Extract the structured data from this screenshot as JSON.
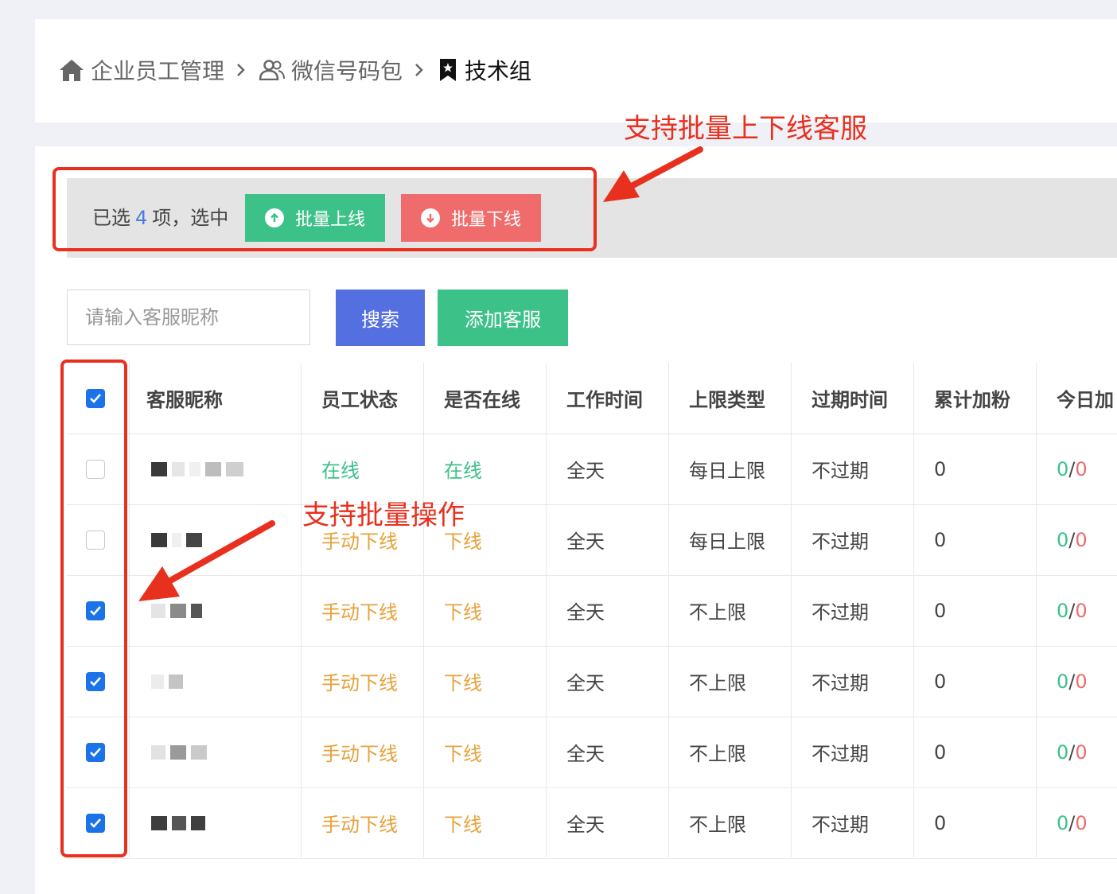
{
  "breadcrumb": {
    "items": [
      {
        "label": "企业员工管理",
        "icon": "home-icon"
      },
      {
        "label": "微信号码包",
        "icon": "users-icon"
      },
      {
        "label": "技术组",
        "icon": "bookmark-icon"
      }
    ]
  },
  "batch": {
    "prefix": "已选",
    "count": "4",
    "suffix": "项，选中",
    "online_label": "批量上线",
    "offline_label": "批量下线"
  },
  "search": {
    "placeholder": "请输入客服昵称",
    "search_label": "搜索",
    "add_label": "添加客服"
  },
  "table": {
    "header_checked": true,
    "columns": [
      "客服昵称",
      "员工状态",
      "是否在线",
      "工作时间",
      "上限类型",
      "过期时间",
      "累计加粉",
      "今日加"
    ],
    "rows": [
      {
        "checked": false,
        "status": "在线",
        "online": "在线",
        "work_time": "全天",
        "limit_type": "每日上限",
        "expire": "不过期",
        "total_fans": "0",
        "today_a": "0",
        "today_sep": "/",
        "today_b": "0"
      },
      {
        "checked": false,
        "status": "手动下线",
        "online": "下线",
        "work_time": "全天",
        "limit_type": "每日上限",
        "expire": "不过期",
        "total_fans": "0",
        "today_a": "0",
        "today_sep": "/",
        "today_b": "0"
      },
      {
        "checked": true,
        "status": "手动下线",
        "online": "下线",
        "work_time": "全天",
        "limit_type": "不上限",
        "expire": "不过期",
        "total_fans": "0",
        "today_a": "0",
        "today_sep": "/",
        "today_b": "0"
      },
      {
        "checked": true,
        "status": "手动下线",
        "online": "下线",
        "work_time": "全天",
        "limit_type": "不上限",
        "expire": "不过期",
        "total_fans": "0",
        "today_a": "0",
        "today_sep": "/",
        "today_b": "0"
      },
      {
        "checked": true,
        "status": "手动下线",
        "online": "下线",
        "work_time": "全天",
        "limit_type": "不上限",
        "expire": "不过期",
        "total_fans": "0",
        "today_a": "0",
        "today_sep": "/",
        "today_b": "0"
      },
      {
        "checked": true,
        "status": "手动下线",
        "online": "下线",
        "work_time": "全天",
        "limit_type": "不上限",
        "expire": "不过期",
        "total_fans": "0",
        "today_a": "0",
        "today_sep": "/",
        "today_b": "0"
      }
    ]
  },
  "annotations": {
    "batch_online_offline": "支持批量上下线客服",
    "batch_operation": "支持批量操作"
  },
  "colors": {
    "green": "#3cc189",
    "orange": "#e6a23c",
    "red": "#f06c6c",
    "blue": "#5470e0",
    "annotation": "#e8301f"
  }
}
